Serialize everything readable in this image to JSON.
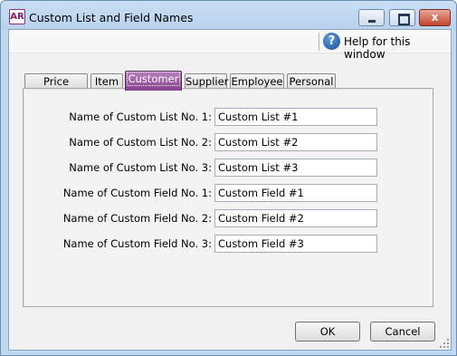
{
  "window": {
    "app_logo": "AR",
    "title": "Custom List and Field Names",
    "close_glyph": "x"
  },
  "toolbar": {
    "help_icon": "?",
    "help_label": "Help for this window"
  },
  "tabs": [
    {
      "label": "Price Levels",
      "active": false
    },
    {
      "label": "Item",
      "active": false
    },
    {
      "label": "Customer",
      "active": true
    },
    {
      "label": "Supplier",
      "active": false
    },
    {
      "label": "Employee",
      "active": false
    },
    {
      "label": "Personal",
      "active": false
    }
  ],
  "fields": [
    {
      "label": "Name of Custom List No. 1:",
      "value": "Custom List #1"
    },
    {
      "label": "Name of Custom List No. 2:",
      "value": "Custom List #2"
    },
    {
      "label": "Name of Custom List No. 3:",
      "value": "Custom List #3"
    },
    {
      "label": "Name of Custom Field No. 1:",
      "value": "Custom Field #1"
    },
    {
      "label": "Name of Custom Field No. 2:",
      "value": "Custom Field #2"
    },
    {
      "label": "Name of Custom Field No. 3:",
      "value": "Custom Field #3"
    }
  ],
  "buttons": {
    "ok": "OK",
    "cancel": "Cancel"
  },
  "colors": {
    "active_tab": "#8a3e95",
    "help_icon": "#1a4f96",
    "titlebar": "#bfd7ef"
  }
}
